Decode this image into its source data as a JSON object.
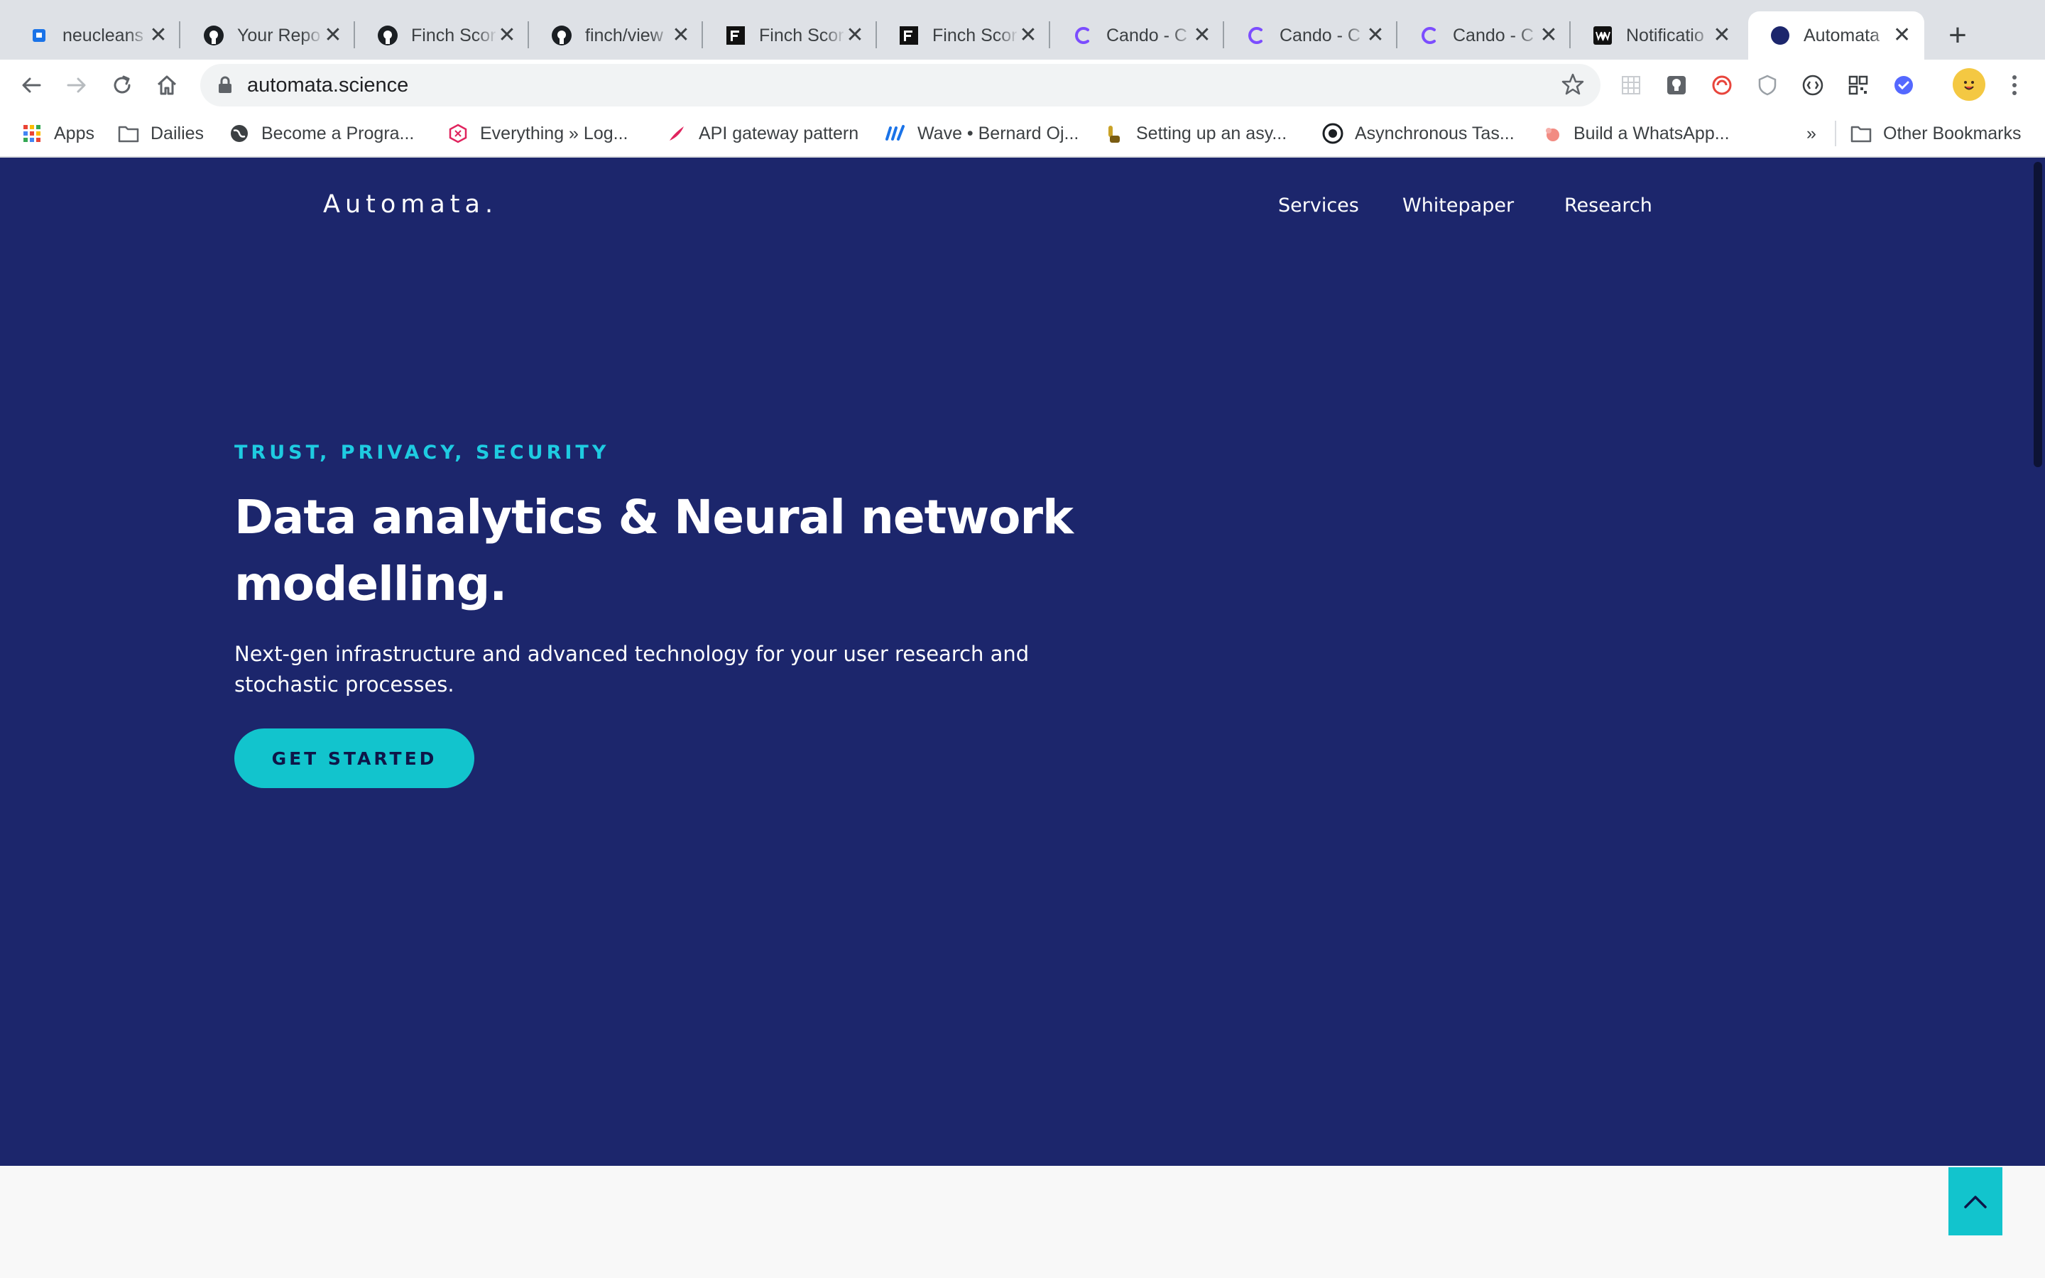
{
  "browser": {
    "tabs": [
      {
        "title": "neucleans",
        "icon": "blue-square-icon"
      },
      {
        "title": "Your Repo",
        "icon": "github-icon"
      },
      {
        "title": "Finch Scor",
        "icon": "github-icon"
      },
      {
        "title": "finch/view",
        "icon": "github-icon"
      },
      {
        "title": "Finch Scor",
        "icon": "finch-black-icon"
      },
      {
        "title": "Finch Scor",
        "icon": "finch-black-icon"
      },
      {
        "title": "Cando - C",
        "icon": "cando-c-icon"
      },
      {
        "title": "Cando - C",
        "icon": "cando-c-icon"
      },
      {
        "title": "Cando - C",
        "icon": "cando-c-icon"
      },
      {
        "title": "Notificatio",
        "icon": "ww-icon"
      },
      {
        "title": "Automata",
        "icon": "navy-circle-icon",
        "active": true
      }
    ],
    "close_glyph": "✕",
    "new_tab_glyph": "+",
    "url": "automata.science",
    "bookmarks": [
      {
        "label": "Apps",
        "icon": "apps-grid-icon"
      },
      {
        "label": "Dailies",
        "icon": "folder-icon"
      },
      {
        "label": "Become a Progra...",
        "icon": "globe-icon"
      },
      {
        "label": "Everything » Log...",
        "icon": "hexagon-icon"
      },
      {
        "label": "API gateway pattern",
        "icon": "brush-icon"
      },
      {
        "label": "Wave • Bernard Oj...",
        "icon": "wave-icon"
      },
      {
        "label": "Setting up an asy...",
        "icon": "hand-icon"
      },
      {
        "label": "Asynchronous Tas...",
        "icon": "round-logo-icon"
      },
      {
        "label": "Build a WhatsApp...",
        "icon": "pink-icon"
      }
    ],
    "bookmarks_overflow": "»",
    "other_bookmarks": "Other Bookmarks"
  },
  "site": {
    "brand": "Automata.",
    "nav": [
      "Services",
      "Whitepaper",
      "Research"
    ],
    "eyebrow": "TRUST, PRIVACY, SECURITY",
    "headline_line1": "Data analytics & Neural network",
    "headline_line2": "modelling.",
    "subline_line1": "Next-gen infrastructure and advanced technology for your user research and",
    "subline_line2": "stochastic processes.",
    "cta": "GET STARTED"
  },
  "colors": {
    "hero_bg": "#1c266c",
    "accent": "#12c4cd",
    "eyebrow": "#1ecbe1"
  }
}
